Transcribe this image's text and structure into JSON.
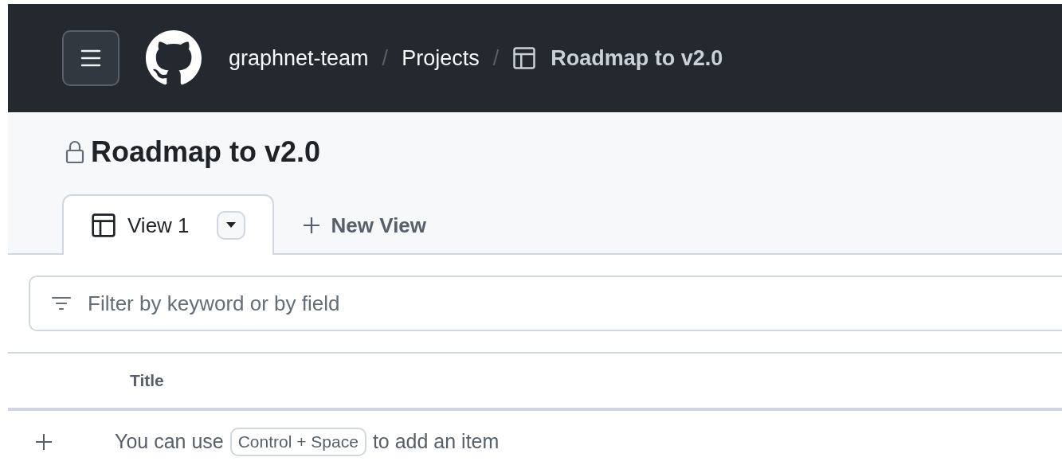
{
  "header": {
    "separator": "/",
    "breadcrumbs": [
      {
        "label": "graphnet-team",
        "kind": "link"
      },
      {
        "label": "Projects",
        "kind": "link"
      },
      {
        "label": "Roadmap to v2.0",
        "kind": "current"
      }
    ]
  },
  "project": {
    "title": "Roadmap to v2.0",
    "private": true
  },
  "views": [
    {
      "label": "View 1",
      "selected": true
    },
    {
      "label": "New View",
      "kind": "new",
      "selected": false
    }
  ],
  "filter": {
    "placeholder": "Filter by keyword or by field"
  },
  "table": {
    "columns": [
      "Title"
    ],
    "add_row": {
      "before": "You can use",
      "shortcut": "Control + Space",
      "after": "to add an item"
    }
  }
}
